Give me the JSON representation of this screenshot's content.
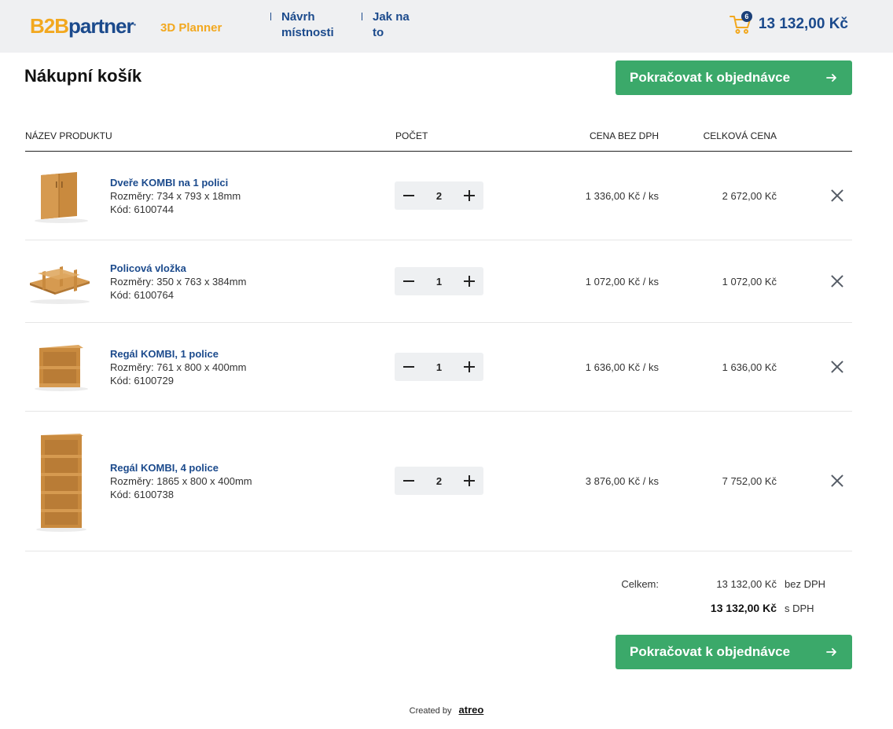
{
  "header": {
    "logo_b2b": "B2B",
    "logo_partner": "partner",
    "planner": "3D Planner",
    "nav": [
      {
        "label": "Návrh místnosti"
      },
      {
        "label": "Jak na to"
      }
    ],
    "cart_count": "6",
    "cart_total": "13 132,00 Kč"
  },
  "page": {
    "title": "Nákupní košík",
    "cta_label": "Pokračovat k objednávce"
  },
  "table": {
    "columns": {
      "name": "NÁZEV PRODUKTU",
      "qty": "POČET",
      "price": "CENA BEZ DPH",
      "total": "CELKOVÁ CENA"
    },
    "rows": [
      {
        "name": "Dveře KOMBI na 1 polici",
        "dims": "Rozměry: 734 x 793 x 18mm",
        "code": "Kód: 6100744",
        "qty": "2",
        "unit_price": "1 336,00 Kč / ks",
        "total": "2 672,00 Kč",
        "image": "door-image"
      },
      {
        "name": "Policová vložka",
        "dims": "Rozměry: 350 x 763 x 384mm",
        "code": "Kód: 6100764",
        "qty": "1",
        "unit_price": "1 072,00 Kč / ks",
        "total": "1 072,00 Kč",
        "image": "shelf-insert-image"
      },
      {
        "name": "Regál KOMBI, 1 police",
        "dims": "Rozměry: 761 x 800 x 400mm",
        "code": "Kód: 6100729",
        "qty": "1",
        "unit_price": "1 636,00 Kč / ks",
        "total": "1 636,00 Kč",
        "image": "small-shelf-image"
      },
      {
        "name": "Regál KOMBI, 4 police",
        "dims": "Rozměry: 1865 x 800 x 400mm",
        "code": "Kód: 6100738",
        "qty": "2",
        "unit_price": "3 876,00 Kč / ks",
        "total": "7 752,00 Kč",
        "image": "tall-shelf-image"
      }
    ]
  },
  "summary": {
    "label": "Celkem:",
    "net": "13 132,00 Kč",
    "net_suffix": "bez DPH",
    "gross": "13 132,00 Kč",
    "gross_suffix": "s DPH"
  },
  "footer": {
    "created_by": "Created by",
    "brand": "atreo"
  },
  "colors": {
    "brand_blue": "#1b4a8c",
    "brand_orange": "#f2a81f",
    "cta_green": "#3ba96a",
    "wood": "#c98a3e"
  }
}
